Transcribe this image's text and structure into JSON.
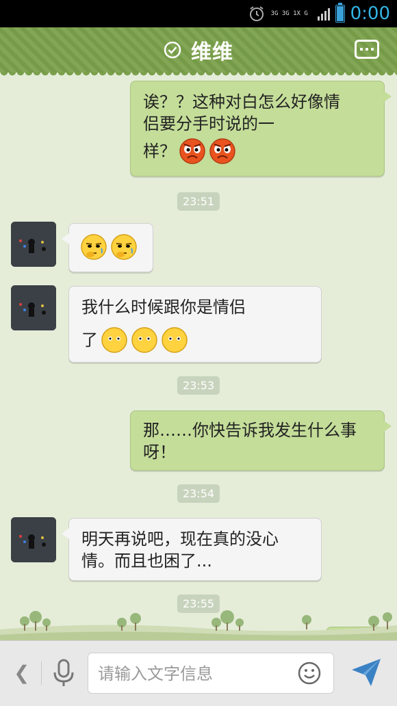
{
  "status_bar": {
    "network": "3G 3G 1X G",
    "time": "0:00"
  },
  "header": {
    "contact_name": "维维"
  },
  "messages": [
    {
      "dir": "out",
      "text_line1": "诶？？这种对白怎么好像情",
      "text_line2": "侣要分手时说的一",
      "text_line3": "样？"
    },
    {
      "timestamp": "23:51"
    },
    {
      "dir": "in",
      "emojis": 2
    },
    {
      "dir": "in",
      "text_line1": "我什么时候跟你是情侣",
      "text_line2": "了"
    },
    {
      "timestamp": "23:53"
    },
    {
      "dir": "out",
      "text_line1": "那……你快告诉我发生什么事",
      "text_line2": "呀！"
    },
    {
      "timestamp": "23:54"
    },
    {
      "dir": "in",
      "text_line1": "明天再说吧，现在真的没心",
      "text_line2": "情。而且也困了..."
    },
    {
      "timestamp": "23:55"
    }
  ],
  "input": {
    "placeholder": "请输入文字信息"
  },
  "colors": {
    "header_green": "#7aa04a",
    "out_bubble": "#c4dd99",
    "in_bubble": "#f5f5f5",
    "time_accent": "#33b5e5"
  },
  "icons": [
    "alarm-icon",
    "signal-icon",
    "battery-icon",
    "check-icon",
    "menu-icon",
    "back-icon",
    "microphone-icon",
    "smiley-icon",
    "send-icon"
  ]
}
